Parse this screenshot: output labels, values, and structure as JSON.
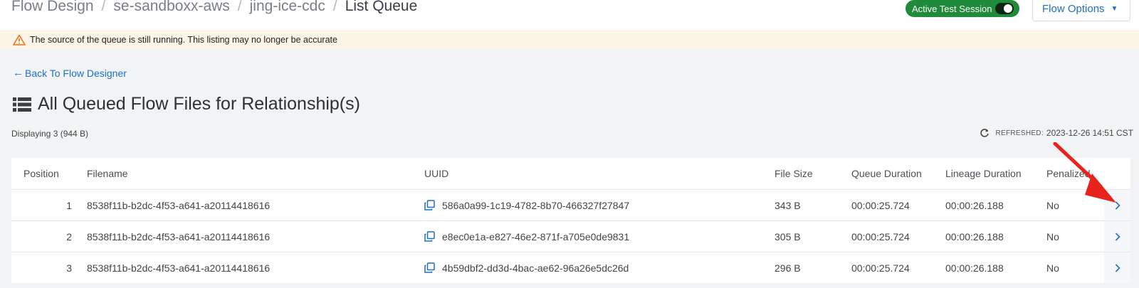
{
  "breadcrumb": {
    "items": [
      "Flow Design",
      "se-sandboxx-aws",
      "jing-ice-cdc"
    ],
    "current": "List Queue",
    "separator": "/"
  },
  "session_toggle": {
    "label": "Active Test Session",
    "state": "on",
    "color": "#1f8a3a"
  },
  "flow_options": {
    "label": "Flow Options"
  },
  "warning": {
    "text": "The source of the queue is still running. This listing may no longer be accurate",
    "icon": "warning-triangle-icon"
  },
  "back_link": {
    "label": "Back To Flow Designer",
    "icon": "arrow-left-icon"
  },
  "page_title": {
    "text": "All Queued Flow Files for Relationship(s)",
    "icon": "list-icon"
  },
  "summary": {
    "displaying": "Displaying 3 (944 B)"
  },
  "refreshed": {
    "label": "REFRESHED:",
    "value": "2023-12-26 14:51 CST",
    "icon": "refresh-icon"
  },
  "table": {
    "columns": [
      "Position",
      "Filename",
      "UUID",
      "File Size",
      "Queue Duration",
      "Lineage Duration",
      "Penalized"
    ],
    "rows": [
      {
        "position": "1",
        "filename": "8538f11b-b2dc-4f53-a641-a20114418616",
        "uuid": "586a0a99-1c19-4782-8b70-466327f27847",
        "size": "343 B",
        "queue_duration": "00:00:25.724",
        "lineage_duration": "00:00:26.188",
        "penalized": "No"
      },
      {
        "position": "2",
        "filename": "8538f11b-b2dc-4f53-a641-a20114418616",
        "uuid": "e8ec0e1a-e827-46e2-871f-a705e0de9831",
        "size": "305 B",
        "queue_duration": "00:00:25.724",
        "lineage_duration": "00:00:26.188",
        "penalized": "No"
      },
      {
        "position": "3",
        "filename": "8538f11b-b2dc-4f53-a641-a20114418616",
        "uuid": "4b59dbf2-dd3d-4bac-ae62-96a26e5dc26d",
        "size": "296 B",
        "queue_duration": "00:00:25.724",
        "lineage_duration": "00:00:26.188",
        "penalized": "No"
      }
    ]
  },
  "colors": {
    "accent": "#1d6fc9",
    "warning_bg": "#fdf4e7",
    "annotation": "#e8231c"
  }
}
